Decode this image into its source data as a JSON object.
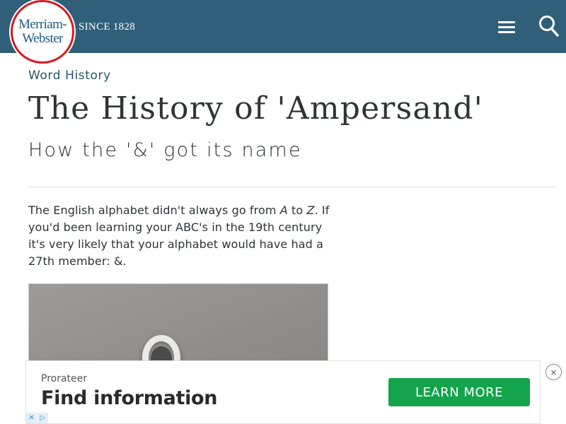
{
  "header": {
    "logo_line1": "Merriam-",
    "logo_line2": "Webster",
    "tagline": "SINCE 1828",
    "menu_icon": "hamburger-menu-icon",
    "search_icon": "search-icon",
    "background_color": "#305f7a"
  },
  "article": {
    "category": "Word History",
    "title": "The History of 'Ampersand'",
    "subtitle": "How the '&' got its name",
    "intro": {
      "part1": "The English alphabet didn't always go from ",
      "letter_a": "A",
      "part2": " to ",
      "letter_z": "Z",
      "part3": ". If you'd been learning your ABC's in the 19th century it's very likely that your alphabet would have had a 27th member: &."
    }
  },
  "ad": {
    "brand": "Prorateer",
    "headline": "Find information",
    "cta": "LEARN MORE",
    "cta_color": "#14a44d",
    "choices_icon_1": "✕",
    "choices_icon_2": "▷",
    "close_symbol": "×"
  }
}
